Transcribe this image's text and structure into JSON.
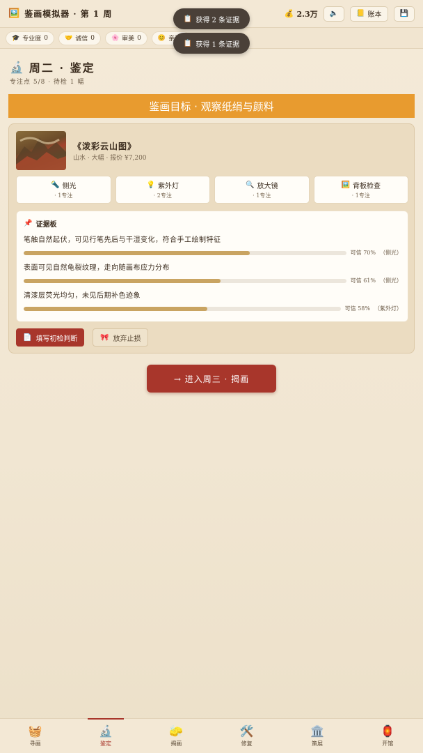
{
  "header": {
    "title": "鉴画模拟器 · 第 1 周",
    "title_icon": "painting-icon",
    "money": "2.3万",
    "sound_icon": "speaker-icon",
    "ledger_label": "账本",
    "save_icon": "save-icon"
  },
  "stats": [
    {
      "icon": "🎓",
      "label": "专业度",
      "value": "0"
    },
    {
      "icon": "🤝",
      "label": "诚信",
      "value": "0"
    },
    {
      "icon": "🌸",
      "label": "审美",
      "value": "0"
    },
    {
      "icon": "😊",
      "label": "亲和",
      "value": ""
    }
  ],
  "toasts": [
    "获得 2 条证据",
    "获得 1 条证据"
  ],
  "day": {
    "title": "周二 · 鉴定",
    "sub": "专注点 5/8 · 待检 1 幅",
    "banner": "鉴画目标 · 观察纸绢与颜料"
  },
  "painting": {
    "name": "《泼彩云山图》",
    "meta": "山水 · 大幅 · 报价 ¥7,200"
  },
  "tools": [
    {
      "icon": "🔦",
      "label": "侧光",
      "cost": "· 1专注"
    },
    {
      "icon": "💡",
      "label": "紫外灯",
      "cost": "· 2专注"
    },
    {
      "icon": "🔍",
      "label": "放大镜",
      "cost": "· 1专注"
    },
    {
      "icon": "🖼️",
      "label": "背板检查",
      "cost": "· 1专注"
    }
  ],
  "evidence": {
    "title": "证据板",
    "items": [
      {
        "text": "笔触自然起伏，可见行笔先后与干湿变化，符合手工绘制特征",
        "confidence": "可信 70%",
        "source": "（侧光）",
        "value": 70
      },
      {
        "text": "表面可见自然龟裂纹理，走向随画布应力分布",
        "confidence": "可信 61%",
        "source": "（侧光）",
        "value": 61
      },
      {
        "text": "清漆层荧光均匀，未见后期补色迹象",
        "confidence": "可信 58%",
        "source": "（紫外灯）",
        "value": 58
      }
    ]
  },
  "actions": {
    "diagnose": "填写初检判断",
    "give_up": "放弃止损",
    "next": "→ 进入周三 · 揭画"
  },
  "nav": [
    {
      "icon": "🧺",
      "label": "寻画",
      "active": false
    },
    {
      "icon": "🔬",
      "label": "鉴定",
      "active": true
    },
    {
      "icon": "🧽",
      "label": "揭画",
      "active": false
    },
    {
      "icon": "🛠️",
      "label": "修复",
      "active": false
    },
    {
      "icon": "🏛️",
      "label": "策展",
      "active": false
    },
    {
      "icon": "🏮",
      "label": "开馆",
      "active": false
    }
  ]
}
